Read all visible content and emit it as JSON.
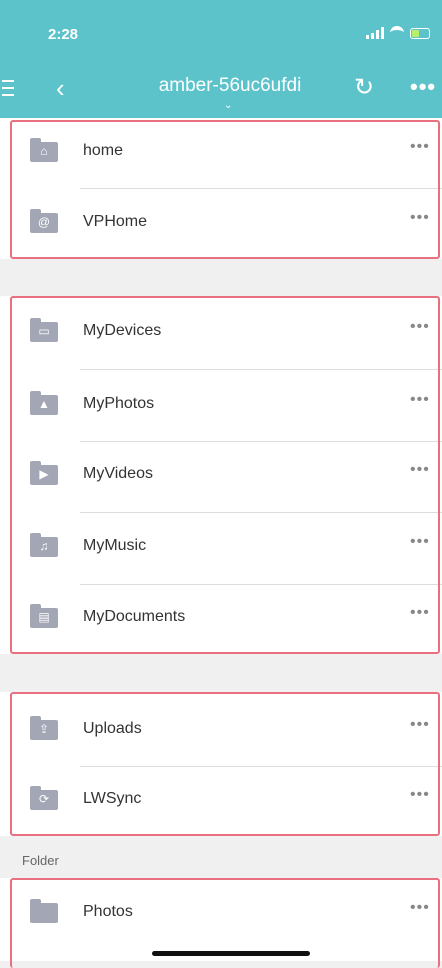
{
  "status": {
    "time": "2:28"
  },
  "nav": {
    "title": "amber-56uc6ufdi"
  },
  "groups": [
    {
      "items": [
        {
          "label": "home",
          "icon": "home-icon"
        },
        {
          "label": "VPHome",
          "icon": "at-icon"
        }
      ]
    },
    {
      "items": [
        {
          "label": "MyDevices",
          "icon": "devices-icon"
        },
        {
          "label": "MyPhotos",
          "icon": "photo-icon"
        },
        {
          "label": "MyVideos",
          "icon": "video-icon"
        },
        {
          "label": "MyMusic",
          "icon": "music-icon"
        },
        {
          "label": "MyDocuments",
          "icon": "document-icon"
        }
      ]
    },
    {
      "items": [
        {
          "label": "Uploads",
          "icon": "upload-icon"
        },
        {
          "label": "LWSync",
          "icon": "sync-icon"
        }
      ]
    }
  ],
  "folder_section": {
    "label": "Folder"
  },
  "folders": [
    {
      "label": "Photos",
      "icon": "folder-icon"
    }
  ],
  "more_glyph": "•••",
  "colors": {
    "accent": "#5cc3cb",
    "highlight_border": "#e9707f",
    "folder": "#a3a7b5"
  }
}
